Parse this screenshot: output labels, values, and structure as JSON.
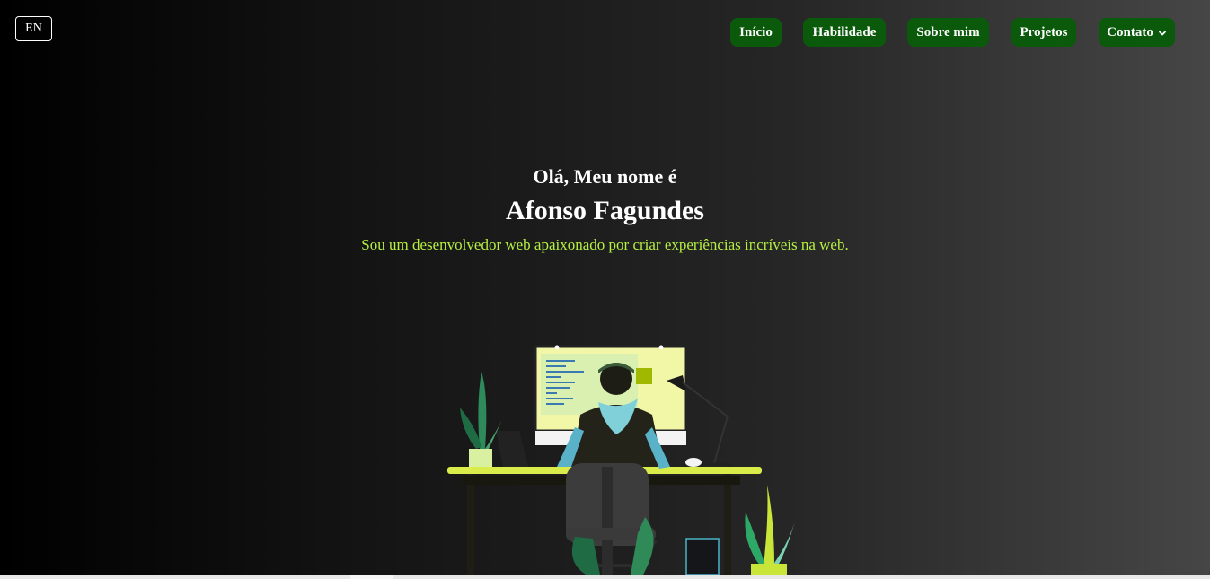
{
  "header": {
    "language_label": "EN"
  },
  "nav": {
    "items": [
      {
        "label": "Início"
      },
      {
        "label": "Habilidade"
      },
      {
        "label": "Sobre mim"
      },
      {
        "label": "Projetos"
      },
      {
        "label": "Contato",
        "icon": "chevron-down-icon"
      }
    ]
  },
  "hero": {
    "greeting": "Olá, Meu nome é",
    "name": "Afonso Fagundes",
    "tagline": "Sou um desenvolvedor web apaixonado por criar experiências incríveis na web."
  },
  "illustration": {
    "subject": "developer-at-desk"
  },
  "colors": {
    "nav_bg": "#0b5a0b",
    "accent": "#b5f040",
    "text": "#ffffff"
  }
}
